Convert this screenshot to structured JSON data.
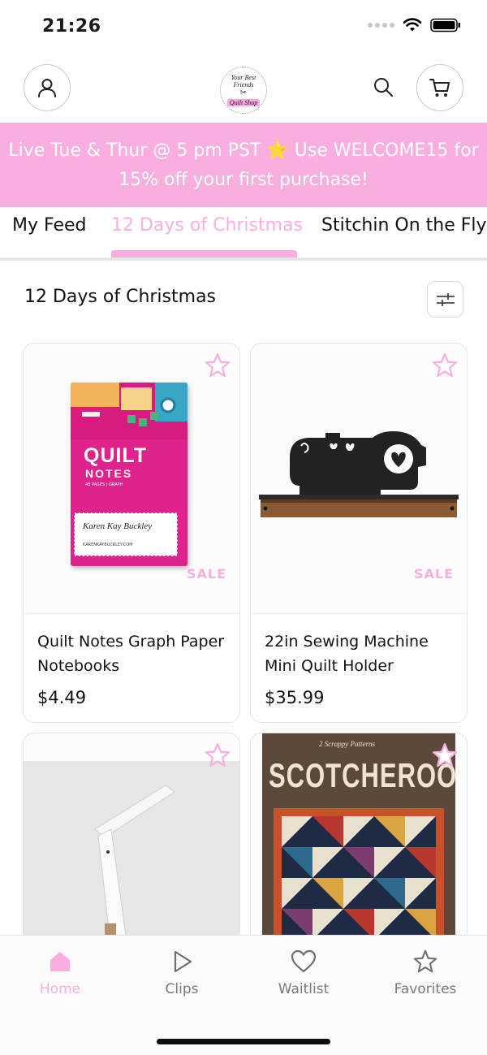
{
  "status_bar": {
    "time": "21:26"
  },
  "header": {
    "logo_line1": "Your Best Friends",
    "logo_line2": "Quilt Shop",
    "icons": [
      "user-icon",
      "search-icon",
      "cart-icon"
    ]
  },
  "promo": {
    "text": "Live Tue & Thur @ 5 pm PST ⭐ Use WELCOME15 for 15% off your first purchase!"
  },
  "tabs": [
    {
      "label": "My Feed",
      "active": false
    },
    {
      "label": "12 Days of Christmas",
      "active": true
    },
    {
      "label": "Stitchin On the Fly",
      "active": false
    }
  ],
  "section": {
    "title": "12 Days of Christmas"
  },
  "products": [
    {
      "name": "Quilt Notes Graph Paper Notebooks",
      "price": "$4.49",
      "badge": "SALE",
      "art": {
        "title": "QUILT",
        "subtitle": "NOTES",
        "tiny": "48 PAGES | GRAPH",
        "author": "Karen Kay Buckley",
        "site": "KARENKAYBUCKLEY.COM"
      }
    },
    {
      "name": "22in Sewing Machine Mini Quilt Holder",
      "price": "$35.99",
      "badge": "SALE"
    },
    {
      "name": "",
      "price": ""
    },
    {
      "name": "",
      "price": "",
      "art": {
        "title": "SCOTCHEROOS",
        "tag": "2 Scrappy Patterns"
      }
    }
  ],
  "bottom_nav": [
    {
      "label": "Home",
      "icon": "home-icon",
      "active": true
    },
    {
      "label": "Clips",
      "icon": "play-icon",
      "active": false
    },
    {
      "label": "Waitlist",
      "icon": "heart-icon",
      "active": false
    },
    {
      "label": "Favorites",
      "icon": "star-icon",
      "active": false
    }
  ],
  "colors": {
    "accent": "#f9aee0",
    "text": "#111111",
    "muted": "#7a7a7a",
    "border": "#e2e2e2"
  }
}
